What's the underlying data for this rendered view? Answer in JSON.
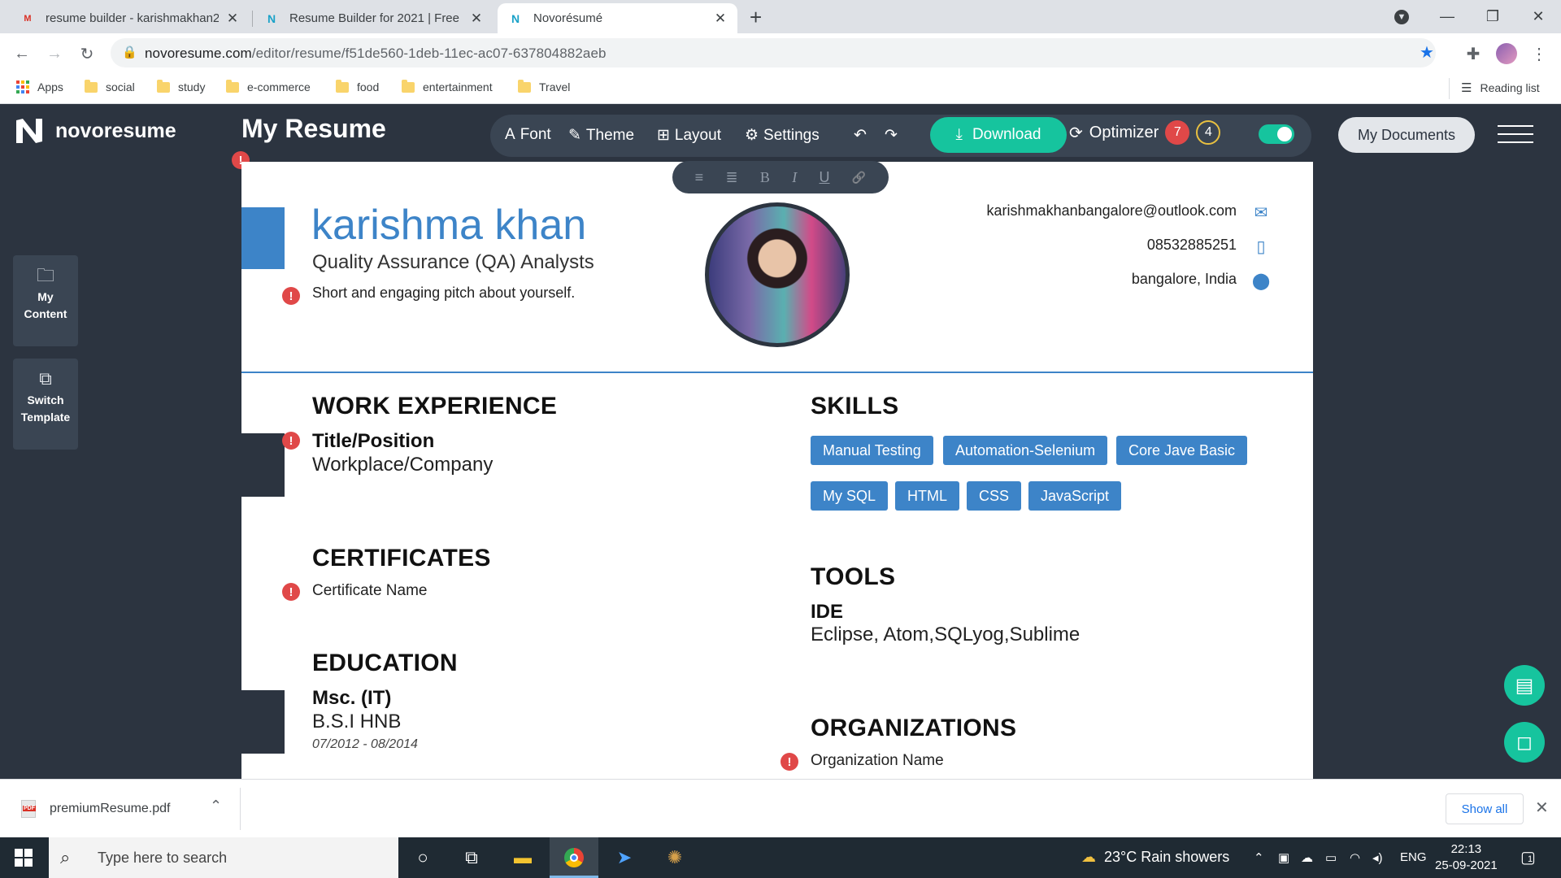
{
  "browser": {
    "tabs": [
      {
        "title": "resume builder - karishmakhan2",
        "favicon": "gmail-icon",
        "active": false
      },
      {
        "title": "Resume Builder for 2021 | Free R",
        "favicon": "novoresume-icon",
        "active": false
      },
      {
        "title": "Novorésumé",
        "favicon": "novoresume-icon",
        "active": true
      }
    ],
    "url_host": "novoresume.com",
    "url_path": "/editor/resume/f51de560-1deb-11ec-ac07-637804882aeb",
    "bookmarks": [
      "Apps",
      "social",
      "study",
      "e-commerce",
      "food",
      "entertainment",
      "Travel"
    ],
    "reading_list": "Reading list"
  },
  "app": {
    "brand": "novoresume",
    "doc_title": "My Resume",
    "toolbar": {
      "font": "Font",
      "theme": "Theme",
      "layout": "Layout",
      "settings": "Settings",
      "download": "Download",
      "optimizer": "Optimizer",
      "optimizer_red_count": "7",
      "optimizer_yellow_count": "4",
      "my_documents": "My Documents"
    },
    "sidebar": {
      "my_content": [
        "My",
        "Content"
      ],
      "switch_template": [
        "Switch",
        "Template"
      ]
    },
    "format_bar": [
      "≡",
      "≣",
      "B",
      "I",
      "U",
      "🔗"
    ],
    "accent_color": "#3d84c8",
    "brand_green": "#16c49e"
  },
  "resume": {
    "name": "karishma khan",
    "role": "Quality Assurance (QA) Analysts",
    "pitch": "Short and engaging pitch about yourself.",
    "email": "karishmakhanbangalore@outlook.com",
    "phone": "08532885251",
    "location": "bangalore, India",
    "work_experience": {
      "heading": "WORK EXPERIENCE",
      "title": "Title/Position",
      "company": "Workplace/Company"
    },
    "certificates": {
      "heading": "CERTIFICATES",
      "item": "Certificate Name"
    },
    "education": {
      "heading": "EDUCATION",
      "degree": "Msc. (IT)",
      "school": "B.S.I HNB",
      "dates": "07/2012 - 08/2014"
    },
    "skills": {
      "heading": "SKILLS",
      "items": [
        "Manual Testing",
        "Automation-Selenium",
        "Core Jave Basic",
        "My SQL",
        "HTML",
        "CSS",
        "JavaScript"
      ]
    },
    "tools": {
      "heading": "TOOLS",
      "category": "IDE",
      "list": "Eclipse, Atom,SQLyog,Sublime"
    },
    "organizations": {
      "heading": "ORGANIZATIONS",
      "item": "Organization Name"
    }
  },
  "downloads": {
    "file": "premiumResume.pdf",
    "show_all": "Show all"
  },
  "taskbar": {
    "search_placeholder": "Type here to search",
    "weather": "23°C  Rain showers",
    "lang": "ENG",
    "time": "22:13",
    "date": "25-09-2021",
    "notification_count": "1"
  }
}
